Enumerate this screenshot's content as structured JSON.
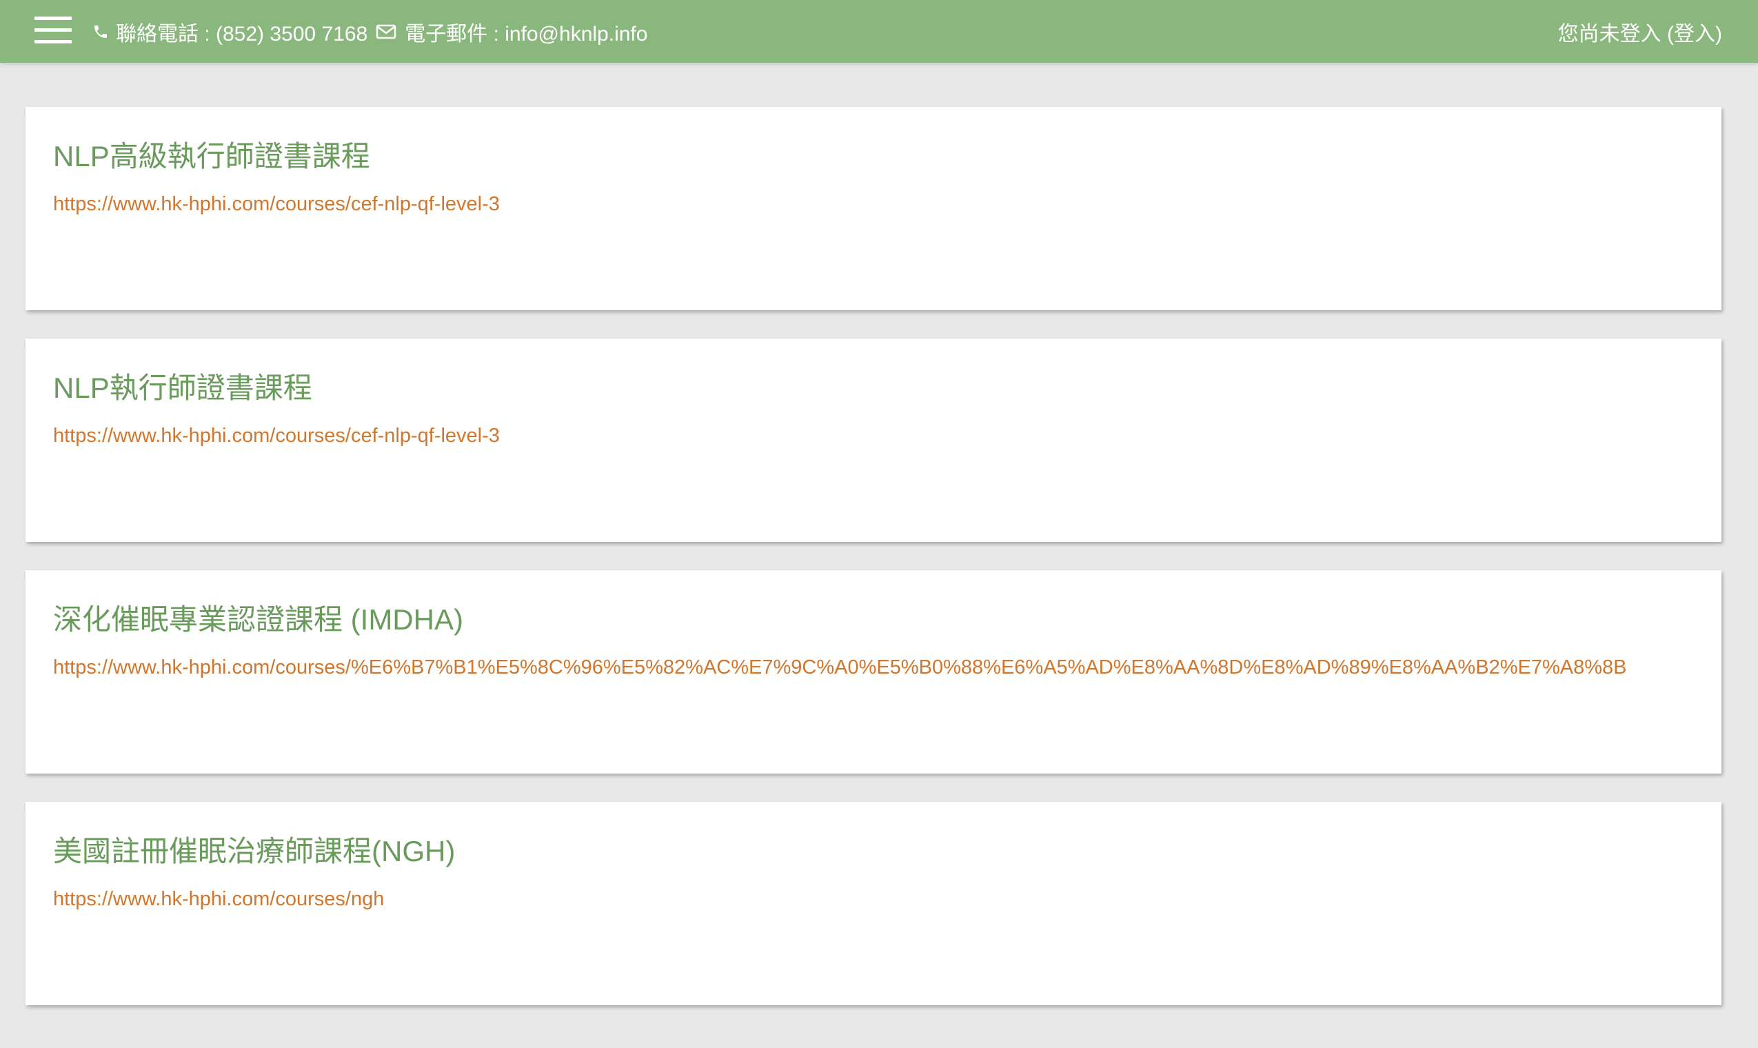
{
  "header": {
    "phone_label": "聯絡電話 : (852) 3500 7168",
    "email_label": "電子郵件 : info@hknlp.info",
    "login_status": "您尚未登入 (登入)",
    "background_color": "#8ab77d",
    "icons": [
      "menu-icon",
      "phone-icon",
      "mail-icon"
    ]
  },
  "courses": [
    {
      "title": "NLP高級執行師證書課程",
      "url": "https://www.hk-hphi.com/courses/cef-nlp-qf-level-3"
    },
    {
      "title": "NLP執行師證書課程",
      "url": "https://www.hk-hphi.com/courses/cef-nlp-qf-level-3"
    },
    {
      "title": "深化催眠專業認證課程 (IMDHA)",
      "url": "https://www.hk-hphi.com/courses/%E6%B7%B1%E5%8C%96%E5%82%AC%E7%9C%A0%E5%B0%88%E6%A5%AD%E8%AA%8D%E8%AD%89%E8%AA%B2%E7%A8%8B"
    },
    {
      "title": "美國註冊催眠治療師課程(NGH)",
      "url": "https://www.hk-hphi.com/courses/ngh"
    }
  ],
  "colors": {
    "title": "#6a9a5c",
    "link": "#d2762b",
    "page_background": "#e8e8e8"
  }
}
